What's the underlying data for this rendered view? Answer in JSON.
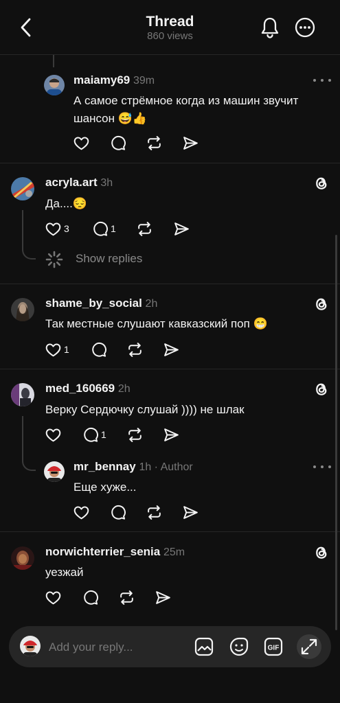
{
  "header": {
    "title": "Thread",
    "views": "860 views"
  },
  "comments": [
    {
      "username": "maiamy69",
      "time": "39m",
      "text_lines": [
        "А самое стрёмное когда из машин звучит",
        "шансон 😅👍"
      ],
      "likes": "",
      "replies": ""
    },
    {
      "username": "acryla.art",
      "time": "3h",
      "text_lines": [
        "Да....😔"
      ],
      "likes": "3",
      "replies": "1",
      "show_replies": "Show replies"
    },
    {
      "username": "shame_by_social",
      "time": "2h",
      "text_lines": [
        "Так местные слушают кавказский поп 😁"
      ],
      "likes": "1",
      "replies": ""
    },
    {
      "username": "med_160669",
      "time": "2h",
      "text_lines": [
        "Верку Сердючку слушай )))) не шлак"
      ],
      "likes": "",
      "replies": "1"
    },
    {
      "username": "mr_bennay",
      "time": "1h · Author",
      "text_lines": [
        "Еще хуже..."
      ],
      "likes": "",
      "replies": ""
    },
    {
      "username": "norwichterrier_senia",
      "time": "25m",
      "text_lines": [
        "уезжай"
      ],
      "likes": "",
      "replies": ""
    }
  ],
  "reply_bar": {
    "placeholder": "Add your reply..."
  },
  "icons": {
    "back": "chevron-left-icon",
    "bell": "bell-icon",
    "more": "more-icon",
    "like": "heart-icon",
    "comment": "comment-icon",
    "repost": "repost-icon",
    "share": "share-icon",
    "threads": "threads-logo-icon",
    "image": "image-icon",
    "sticker": "sticker-icon",
    "gif": "gif-icon",
    "expand": "expand-icon"
  },
  "colors": {
    "background": "#101010",
    "text": "#f3f3f3",
    "muted": "#777777",
    "divider": "#262626"
  }
}
